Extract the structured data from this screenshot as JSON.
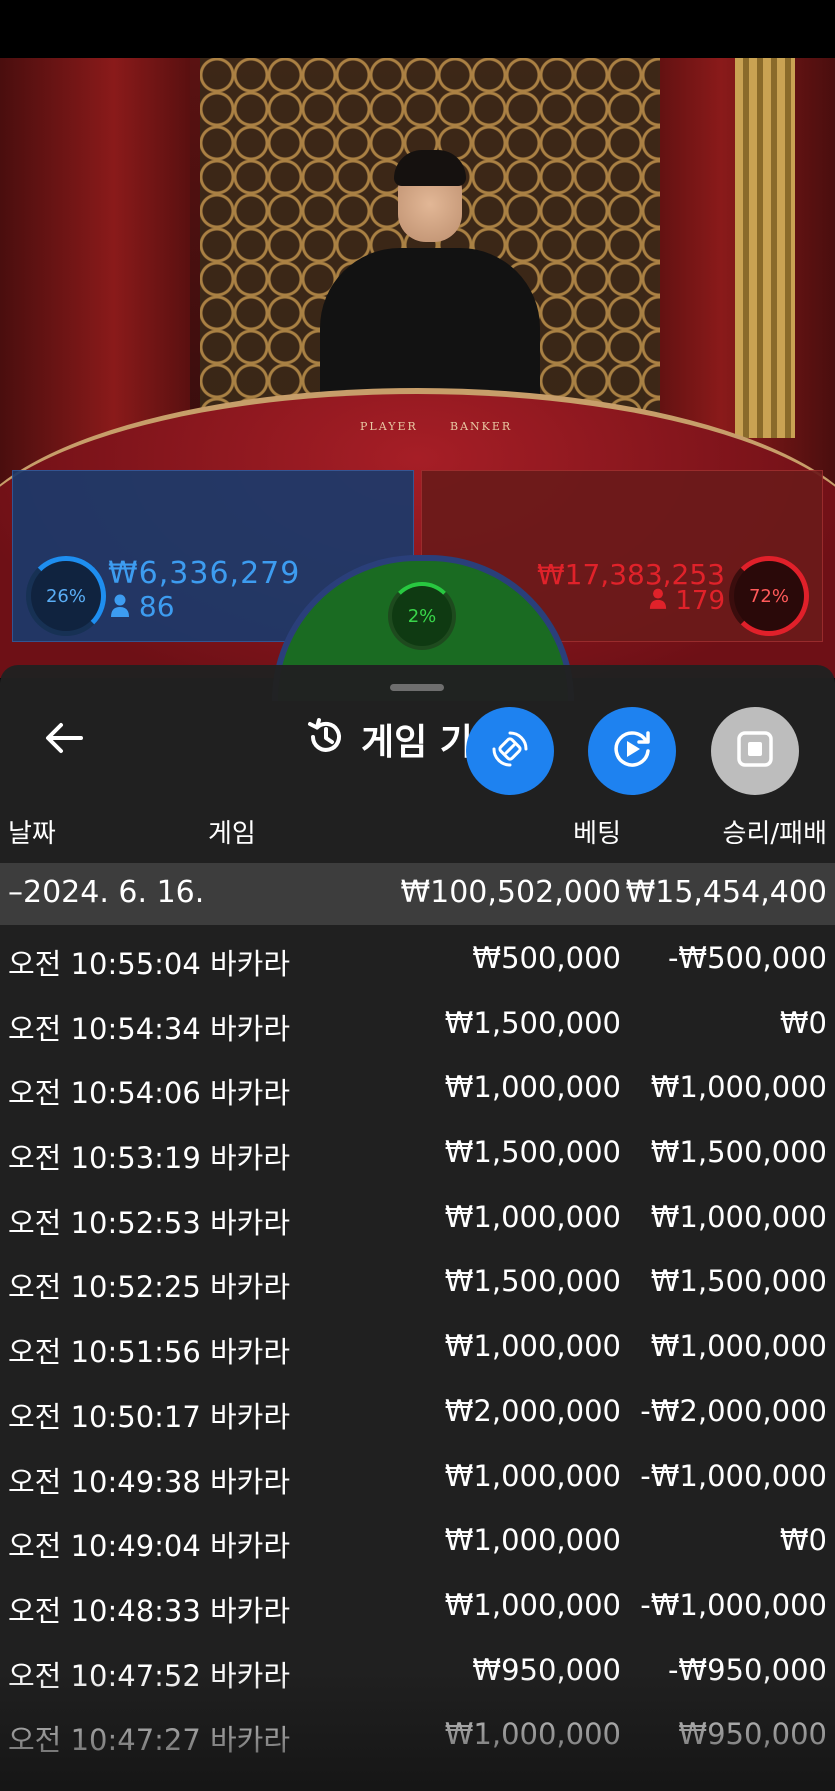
{
  "stats": {
    "player": {
      "percent": "26%",
      "amount": "₩6,336,279",
      "count": "86"
    },
    "banker": {
      "percent": "72%",
      "amount": "₩17,383,253",
      "count": "179"
    },
    "tie": {
      "percent": "2%"
    }
  },
  "video_labels": {
    "player": "PLAYER",
    "banker": "BANKER"
  },
  "sheet": {
    "title": "게임 기록",
    "columns": {
      "date": "날짜",
      "game": "게임",
      "bet": "베팅",
      "result": "승리/패배"
    },
    "date_group": {
      "date": "–2024. 6. 16.",
      "bet_total": "₩100,502,000",
      "result_total": "₩15,454,400"
    },
    "rows": [
      {
        "time": "오전 10:55:04",
        "game": "바카라",
        "bet": "₩500,000",
        "result": "-₩500,000"
      },
      {
        "time": "오전 10:54:34",
        "game": "바카라",
        "bet": "₩1,500,000",
        "result": "₩0"
      },
      {
        "time": "오전 10:54:06",
        "game": "바카라",
        "bet": "₩1,000,000",
        "result": "₩1,000,000"
      },
      {
        "time": "오전 10:53:19",
        "game": "바카라",
        "bet": "₩1,500,000",
        "result": "₩1,500,000"
      },
      {
        "time": "오전 10:52:53",
        "game": "바카라",
        "bet": "₩1,000,000",
        "result": "₩1,000,000"
      },
      {
        "time": "오전 10:52:25",
        "game": "바카라",
        "bet": "₩1,500,000",
        "result": "₩1,500,000"
      },
      {
        "time": "오전 10:51:56",
        "game": "바카라",
        "bet": "₩1,000,000",
        "result": "₩1,000,000"
      },
      {
        "time": "오전 10:50:17",
        "game": "바카라",
        "bet": "₩2,000,000",
        "result": "-₩2,000,000"
      },
      {
        "time": "오전 10:49:38",
        "game": "바카라",
        "bet": "₩1,000,000",
        "result": "-₩1,000,000"
      },
      {
        "time": "오전 10:49:04",
        "game": "바카라",
        "bet": "₩1,000,000",
        "result": "₩0"
      },
      {
        "time": "오전 10:48:33",
        "game": "바카라",
        "bet": "₩1,000,000",
        "result": "-₩1,000,000"
      },
      {
        "time": "오전 10:47:52",
        "game": "바카라",
        "bet": "₩950,000",
        "result": "-₩950,000"
      },
      {
        "time": "오전 10:47:27",
        "game": "바카라",
        "bet": "₩1,000,000",
        "result": "₩950,000"
      }
    ]
  },
  "icons": {
    "back": "arrow-left-icon",
    "history": "history-icon",
    "rotate": "screen-rotate-icon",
    "replay": "video-replay-icon",
    "stop": "stop-square-icon"
  },
  "colors": {
    "accent_blue": "#1e82f0",
    "player_blue": "#3d9cf0",
    "banker_red": "#e0222a",
    "tie_green": "#39d64a",
    "sheet_bg": "#212121"
  }
}
